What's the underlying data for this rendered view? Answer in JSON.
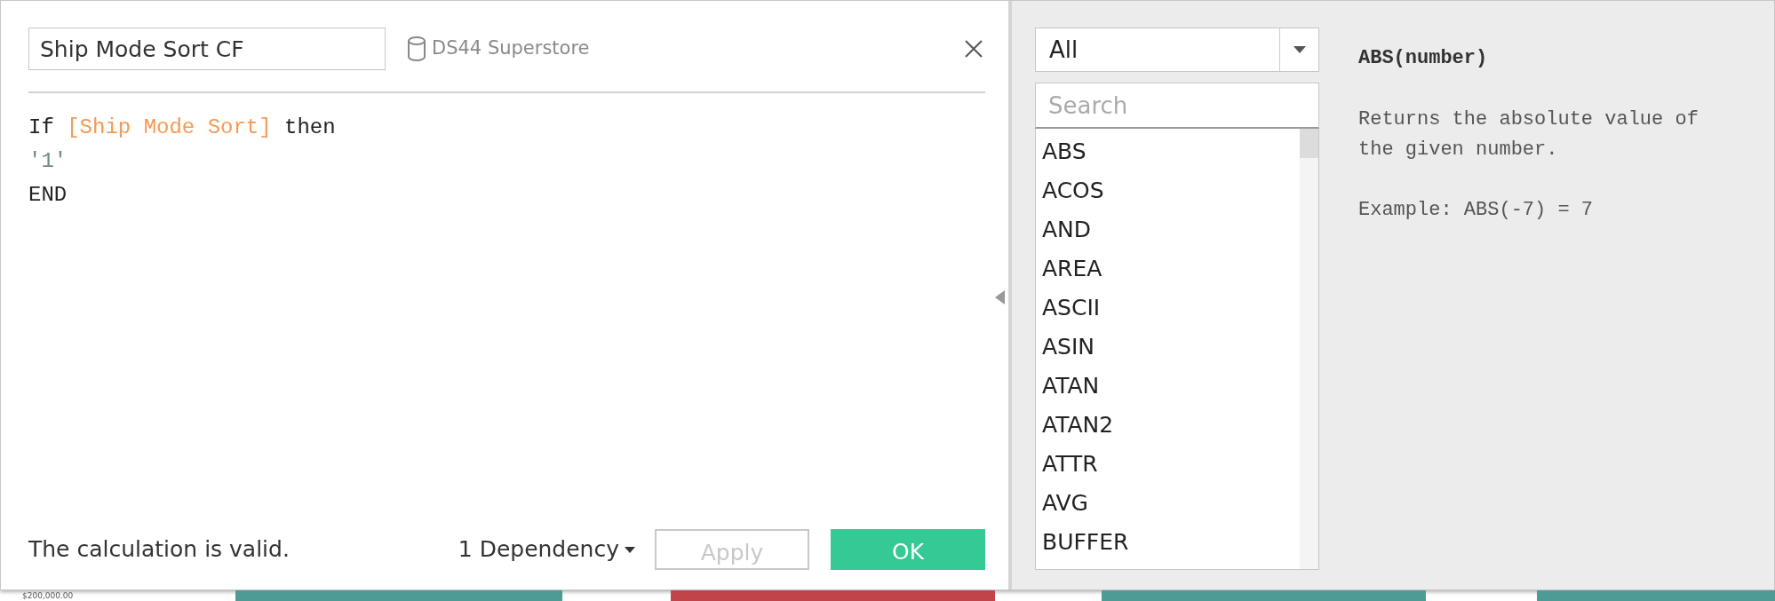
{
  "dialog": {
    "name_field": {
      "value": "Ship Mode Sort CF"
    },
    "data_source": "DS44 Superstore",
    "code_lines": [
      [
        {
          "kind": "keyword",
          "text": "If "
        },
        {
          "kind": "field",
          "text": "[Ship Mode Sort]"
        },
        {
          "kind": "keyword",
          "text": " then"
        }
      ],
      [
        {
          "kind": "string",
          "text": "'1'"
        }
      ],
      [
        {
          "kind": "keyword",
          "text": "END"
        }
      ]
    ],
    "status": "The calculation is valid.",
    "dependency": "1 Dependency",
    "buttons": [
      {
        "label": "Apply",
        "disabled": true,
        "kind": "secondary"
      },
      {
        "label": "OK",
        "disabled": false,
        "kind": "primary"
      }
    ]
  },
  "functions": {
    "category": "All",
    "search": {
      "placeholder": "Search"
    },
    "items": [
      {
        "label": "ABS"
      },
      {
        "label": "ACOS"
      },
      {
        "label": "AND"
      },
      {
        "label": "AREA"
      },
      {
        "label": "ASCII"
      },
      {
        "label": "ASIN"
      },
      {
        "label": "ATAN"
      },
      {
        "label": "ATAN2"
      },
      {
        "label": "ATTR"
      },
      {
        "label": "AVG"
      },
      {
        "label": "BUFFER"
      }
    ]
  },
  "help": {
    "signature": "ABS(number)",
    "description": "Returns the absolute value of the given number.",
    "example": "Example: ABS(-7) = 7"
  },
  "background": {
    "axis_label": "$200,000.00"
  }
}
